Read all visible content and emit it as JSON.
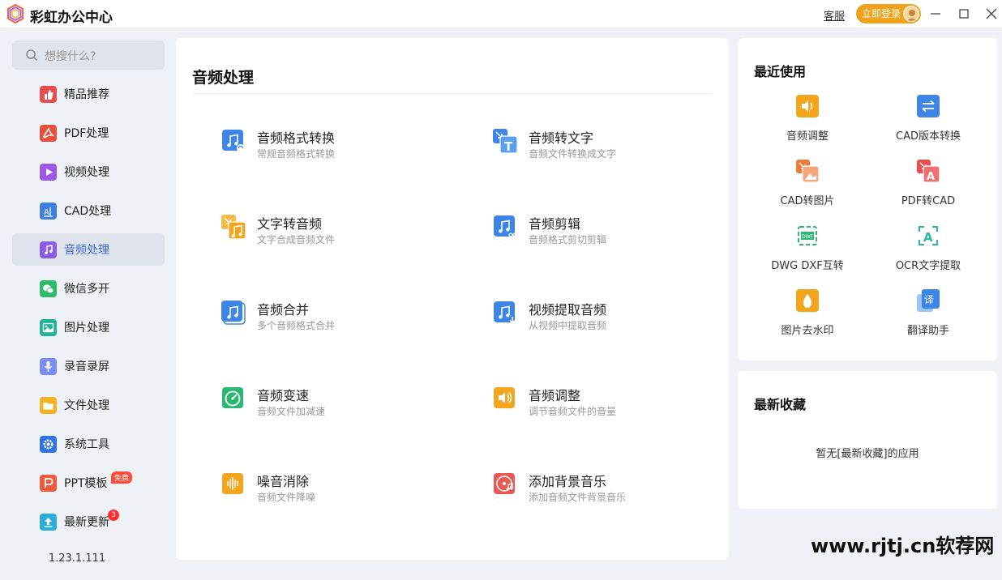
{
  "app": {
    "title": "彩虹办公中心",
    "service_label": "客服",
    "login_label": "立即登录",
    "controls": [
      "minimize-icon",
      "maximize-icon",
      "close-icon"
    ]
  },
  "search": {
    "placeholder": "想搜什么?"
  },
  "sidebar": {
    "items": [
      {
        "label": "精品推荐",
        "icon": "thumbs-up-icon",
        "color": "#e84c4c"
      },
      {
        "label": "PDF处理",
        "icon": "pdf-icon",
        "color": "#e8503e"
      },
      {
        "label": "视频处理",
        "icon": "play-icon",
        "color": "#9b59e6"
      },
      {
        "label": "CAD处理",
        "icon": "cad-icon",
        "color": "#3d7fe0"
      },
      {
        "label": "音频处理",
        "icon": "music-icon",
        "color": "#8a5ae8"
      },
      {
        "label": "微信多开",
        "icon": "wechat-icon",
        "color": "#2dbb6a"
      },
      {
        "label": "图片处理",
        "icon": "image-icon",
        "color": "#22b29a"
      },
      {
        "label": "录音录屏",
        "icon": "microphone-icon",
        "color": "#7b8df0"
      },
      {
        "label": "文件处理",
        "icon": "folder-icon",
        "color": "#f4b322"
      },
      {
        "label": "系统工具",
        "icon": "gear-icon",
        "color": "#2f74e0"
      },
      {
        "label": "PPT模板",
        "icon": "ppt-icon",
        "color": "#ee5a3c",
        "badge": "免费"
      },
      {
        "label": "最新更新",
        "icon": "upload-icon",
        "color": "#2aaed8",
        "badge": "3"
      }
    ],
    "active_index": 4,
    "version": "1.23.1.111"
  },
  "main": {
    "title": "音频处理",
    "tools": [
      {
        "name": "音频格式转换",
        "desc": "常规音频格式转换",
        "icon": "audio-convert-icon",
        "color": "#3d86e8"
      },
      {
        "name": "音频转文字",
        "desc": "音频文件转换成文字",
        "icon": "audio-to-text-icon",
        "color": "#3d86e8"
      },
      {
        "name": "文字转音频",
        "desc": "文字合成音频文件",
        "icon": "text-to-audio-icon",
        "color": "#f3a51e"
      },
      {
        "name": "音频剪辑",
        "desc": "音频格式剪切剪辑",
        "icon": "audio-cut-icon",
        "color": "#3d86e8"
      },
      {
        "name": "音频合并",
        "desc": "多个音频格式合并",
        "icon": "audio-merge-icon",
        "color": "#3d86e8"
      },
      {
        "name": "视频提取音频",
        "desc": "从视频中提取音频",
        "icon": "video-extract-audio-icon",
        "color": "#3d86e8"
      },
      {
        "name": "音频变速",
        "desc": "音频文件加减速",
        "icon": "audio-speed-icon",
        "color": "#2bb772"
      },
      {
        "name": "音频调整",
        "desc": "调节音频文件的音量",
        "icon": "volume-icon",
        "color": "#f3a51e"
      },
      {
        "name": "噪音消除",
        "desc": "音频文件降噪",
        "icon": "noise-reduce-icon",
        "color": "#f3a51e"
      },
      {
        "name": "添加背景音乐",
        "desc": "添加音频文件背景音乐",
        "icon": "background-music-icon",
        "color": "#ea5a55"
      }
    ]
  },
  "recent": {
    "title": "最近使用",
    "items": [
      {
        "label": "音频调整",
        "icon": "volume-icon",
        "color": "#f3a51e"
      },
      {
        "label": "CAD版本转换",
        "icon": "cad-version-icon",
        "color": "#3d86e8"
      },
      {
        "label": "CAD转图片",
        "icon": "cad-to-image-icon",
        "color": "#f07a3a"
      },
      {
        "label": "PDF转CAD",
        "icon": "pdf-to-cad-icon",
        "color": "#ea4f4f"
      },
      {
        "label": "DWG DXF互转",
        "icon": "dwg-dxf-icon",
        "color": "#2bb772"
      },
      {
        "label": "OCR文字提取",
        "icon": "ocr-icon",
        "color": "#2bb79a"
      },
      {
        "label": "图片去水印",
        "icon": "watermark-remove-icon",
        "color": "#f3a51e"
      },
      {
        "label": "翻译助手",
        "icon": "translate-icon",
        "color": "#3d86e8"
      }
    ]
  },
  "favorites": {
    "title": "最新收藏",
    "empty_text": "暂无[最新收藏]的应用"
  },
  "watermark": "www.rjtj.cn软荐网"
}
